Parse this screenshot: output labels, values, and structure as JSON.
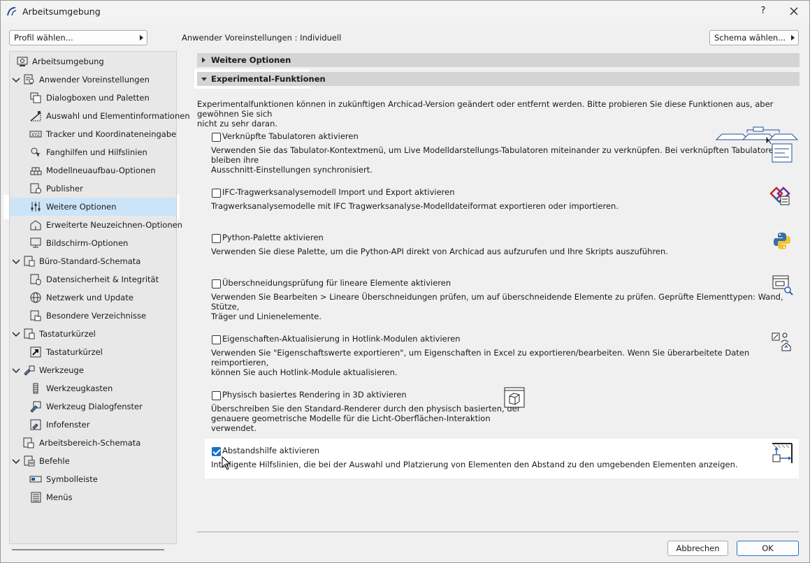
{
  "window": {
    "title": "Arbeitsumgebung",
    "help": "?"
  },
  "toolbar": {
    "profile_button": "Profil wählen...",
    "prefs_label": "Anwender Voreinstellungen : Individuell",
    "schema_button": "Schema wählen..."
  },
  "sidebar": {
    "items": [
      {
        "label": "Arbeitsumgebung",
        "icon": "workspace-icon"
      },
      {
        "label": "Anwender Voreinstellungen",
        "icon": "user-prefs-icon",
        "expanded": true
      },
      {
        "label": "Dialogboxen und Paletten",
        "icon": "dialogs-icon"
      },
      {
        "label": "Auswahl und Elementinformationen",
        "icon": "selection-icon"
      },
      {
        "label": "Tracker und Koordinateneingabe",
        "icon": "xyz-icon"
      },
      {
        "label": "Fanghilfen und Hilfslinien",
        "icon": "snap-icon"
      },
      {
        "label": "Modellneuaufbau-Optionen",
        "icon": "rebuild-icon"
      },
      {
        "label": "Publisher",
        "icon": "publisher-icon"
      },
      {
        "label": "Weitere Optionen",
        "icon": "sliders-icon",
        "selected": true
      },
      {
        "label": "Erweiterte Neuzeichnen-Optionen",
        "icon": "redraw-icon"
      },
      {
        "label": "Bildschirm-Optionen",
        "icon": "screen-icon"
      },
      {
        "label": "Büro-Standard-Schemata",
        "icon": "office-schemes-icon",
        "expanded": true
      },
      {
        "label": "Datensicherheit & Integrität",
        "icon": "data-safety-icon"
      },
      {
        "label": "Netzwerk und Update",
        "icon": "globe-icon"
      },
      {
        "label": "Besondere Verzeichnisse",
        "icon": "folders-icon"
      },
      {
        "label": "Tastaturkürzel",
        "icon": "shortcuts-group-icon",
        "expanded": true
      },
      {
        "label": "Tastaturkürzel",
        "icon": "shortcut-arrow-icon"
      },
      {
        "label": "Werkzeuge",
        "icon": "tools-group-icon",
        "expanded": true
      },
      {
        "label": "Werkzeugkasten",
        "icon": "toolbox-icon"
      },
      {
        "label": "Werkzeug Dialogfenster",
        "icon": "tool-dialog-icon"
      },
      {
        "label": "Infofenster",
        "icon": "info-box-icon"
      },
      {
        "label": "Arbeitsbereich-Schemata",
        "icon": "work-env-schemes-icon"
      },
      {
        "label": "Befehle",
        "icon": "commands-group-icon",
        "expanded": true
      },
      {
        "label": "Symbolleiste",
        "icon": "toolbar-icon"
      },
      {
        "label": "Menüs",
        "icon": "menus-icon"
      }
    ]
  },
  "panel": {
    "section_more": "Weitere Optionen",
    "section_experimental": "Experimental-Funktionen",
    "intro_line1": "Experimentalfunktionen können in zukünftigen Archicad-Version geändert oder entfernt werden. Bitte probieren Sie diese Funktionen aus, aber gewöhnen Sie sich",
    "intro_line2": "nicht zu sehr daran.",
    "features": [
      {
        "title": "Verknüpfte Tabulatoren aktivieren",
        "checked": false,
        "desc1": "Verwenden Sie das Tabulator-Kontextmenü, um Live Modelldarstellungs-Tabulatoren miteinander zu verknüpfen. Bei verknüpften Tabulatoren bleiben ihre",
        "desc2": "Ausschnitt-Einstellungen synchronisiert.",
        "icon": "linked-tabs-icon"
      },
      {
        "title": "IFC-Tragwerksanalysemodell Import und Export aktivieren",
        "checked": false,
        "desc1": "Tragwerksanalysemodelle mit IFC Tragwerksanalyse-Modelldateiformat exportieren oder importieren.",
        "icon": "ifc-structural-icon"
      },
      {
        "title": "Python-Palette aktivieren",
        "checked": false,
        "desc1": "Verwenden Sie diese Palette, um die Python-API direkt von Archicad aus aufzurufen und Ihre Skripts auszuführen.",
        "icon": "python-icon"
      },
      {
        "title": "Überschneidungsprüfung für lineare Elemente aktivieren",
        "checked": false,
        "desc1": "Verwenden Sie Bearbeiten > Lineare Überschneidungen prüfen, um auf überschneidende Elemente zu prüfen. Geprüfte Elementtypen: Wand, Stütze,",
        "desc2": "Träger und Linienelemente.",
        "icon": "overlap-check-icon"
      },
      {
        "title": "Eigenschaften-Aktualisierung in Hotlink-Modulen aktivieren",
        "checked": false,
        "desc1": "Verwenden Sie \"Eigenschaftswerte exportieren\", um Eigenschaften in Excel zu exportieren/bearbeiten. Wenn Sie überarbeitete Daten reimportieren,",
        "desc2": "können Sie auch Hotlink-Module aktualisieren.",
        "icon": "hotlink-properties-icon"
      },
      {
        "title": "Physisch basiertes Rendering in 3D aktivieren",
        "checked": false,
        "desc1": "Überschreiben Sie den Standard-Renderer durch den physisch basierten, der",
        "desc2": "genauere geometrische Modelle für die Licht-Oberflächen-Interaktion",
        "desc3": "verwendet.",
        "icon": "pbr-cube-icon"
      },
      {
        "title": "Abstandshilfe aktivieren",
        "checked": true,
        "desc1": "Intelligente Hilfslinien, die bei der Auswahl und Platzierung von Elementen den Abstand zu den umgebenden Elementen anzeigen.",
        "icon": "distance-guide-icon"
      }
    ]
  },
  "footer": {
    "cancel": "Abbrechen",
    "ok": "OK"
  },
  "colors": {
    "accent": "#1a73c7",
    "selection": "#cce4f7",
    "section_bar": "#d4d4d4"
  }
}
